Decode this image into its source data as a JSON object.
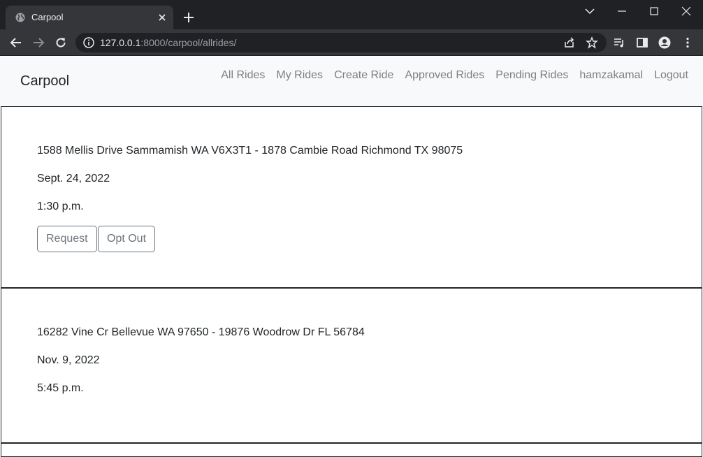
{
  "browser": {
    "tab_title": "Carpool",
    "url_host": "127.0.0.1",
    "url_rest": ":8000/carpool/allrides/"
  },
  "navbar": {
    "brand": "Carpool",
    "links": [
      "All Rides",
      "My Rides",
      "Create Ride",
      "Approved Rides",
      "Pending Rides",
      "hamzakamal",
      "Logout"
    ]
  },
  "rides": [
    {
      "route": "1588 Mellis Drive Sammamish WA V6X3T1 - 1878 Cambie Road Richmond TX 98075",
      "date": "Sept. 24, 2022",
      "time": "1:30 p.m.",
      "request_label": "Request",
      "optout_label": "Opt Out"
    },
    {
      "route": "16282 Vine Cr Bellevue WA 97650 - 19876 Woodrow Dr FL 56784",
      "date": "Nov. 9, 2022",
      "time": "5:45 p.m."
    }
  ]
}
